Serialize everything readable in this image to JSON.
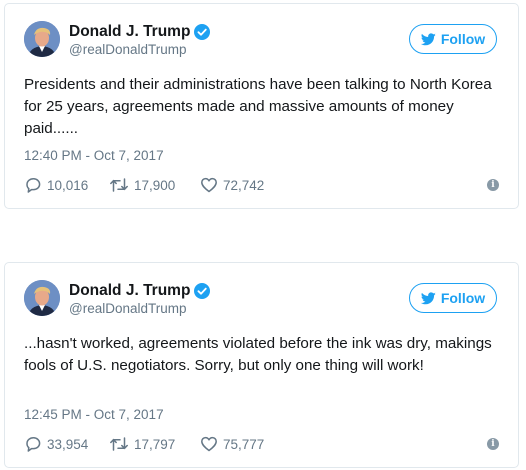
{
  "tweets": [
    {
      "display_name": "Donald J. Trump",
      "handle": "@realDonaldTrump",
      "follow_label": "Follow",
      "text": "Presidents and their administrations have been talking to North Korea for 25 years, agreements made and massive amounts of money paid......",
      "timestamp": "12:40 PM - Oct 7, 2017",
      "replies": "10,016",
      "retweets": "17,900",
      "likes": "72,742",
      "info_glyph": "i"
    },
    {
      "display_name": "Donald J. Trump",
      "handle": "@realDonaldTrump",
      "follow_label": "Follow",
      "text": "...hasn't worked, agreements violated before the ink was dry, makings fools of U.S. negotiators. Sorry, but only one thing will work!",
      "timestamp": "12:45 PM - Oct 7, 2017",
      "replies": "33,954",
      "retweets": "17,797",
      "likes": "75,777",
      "info_glyph": "i"
    }
  ],
  "colors": {
    "accent": "#1da1f2",
    "secondary_text": "#657786",
    "border": "#e1e8ed",
    "info_icon": "#8899a6"
  },
  "icons": {
    "avatar": "avatar",
    "verified": "verified-badge-icon",
    "follow": "twitter-bird-icon",
    "reply": "reply-icon",
    "retweet": "retweet-icon",
    "like": "heart-icon",
    "info": "info-icon"
  }
}
